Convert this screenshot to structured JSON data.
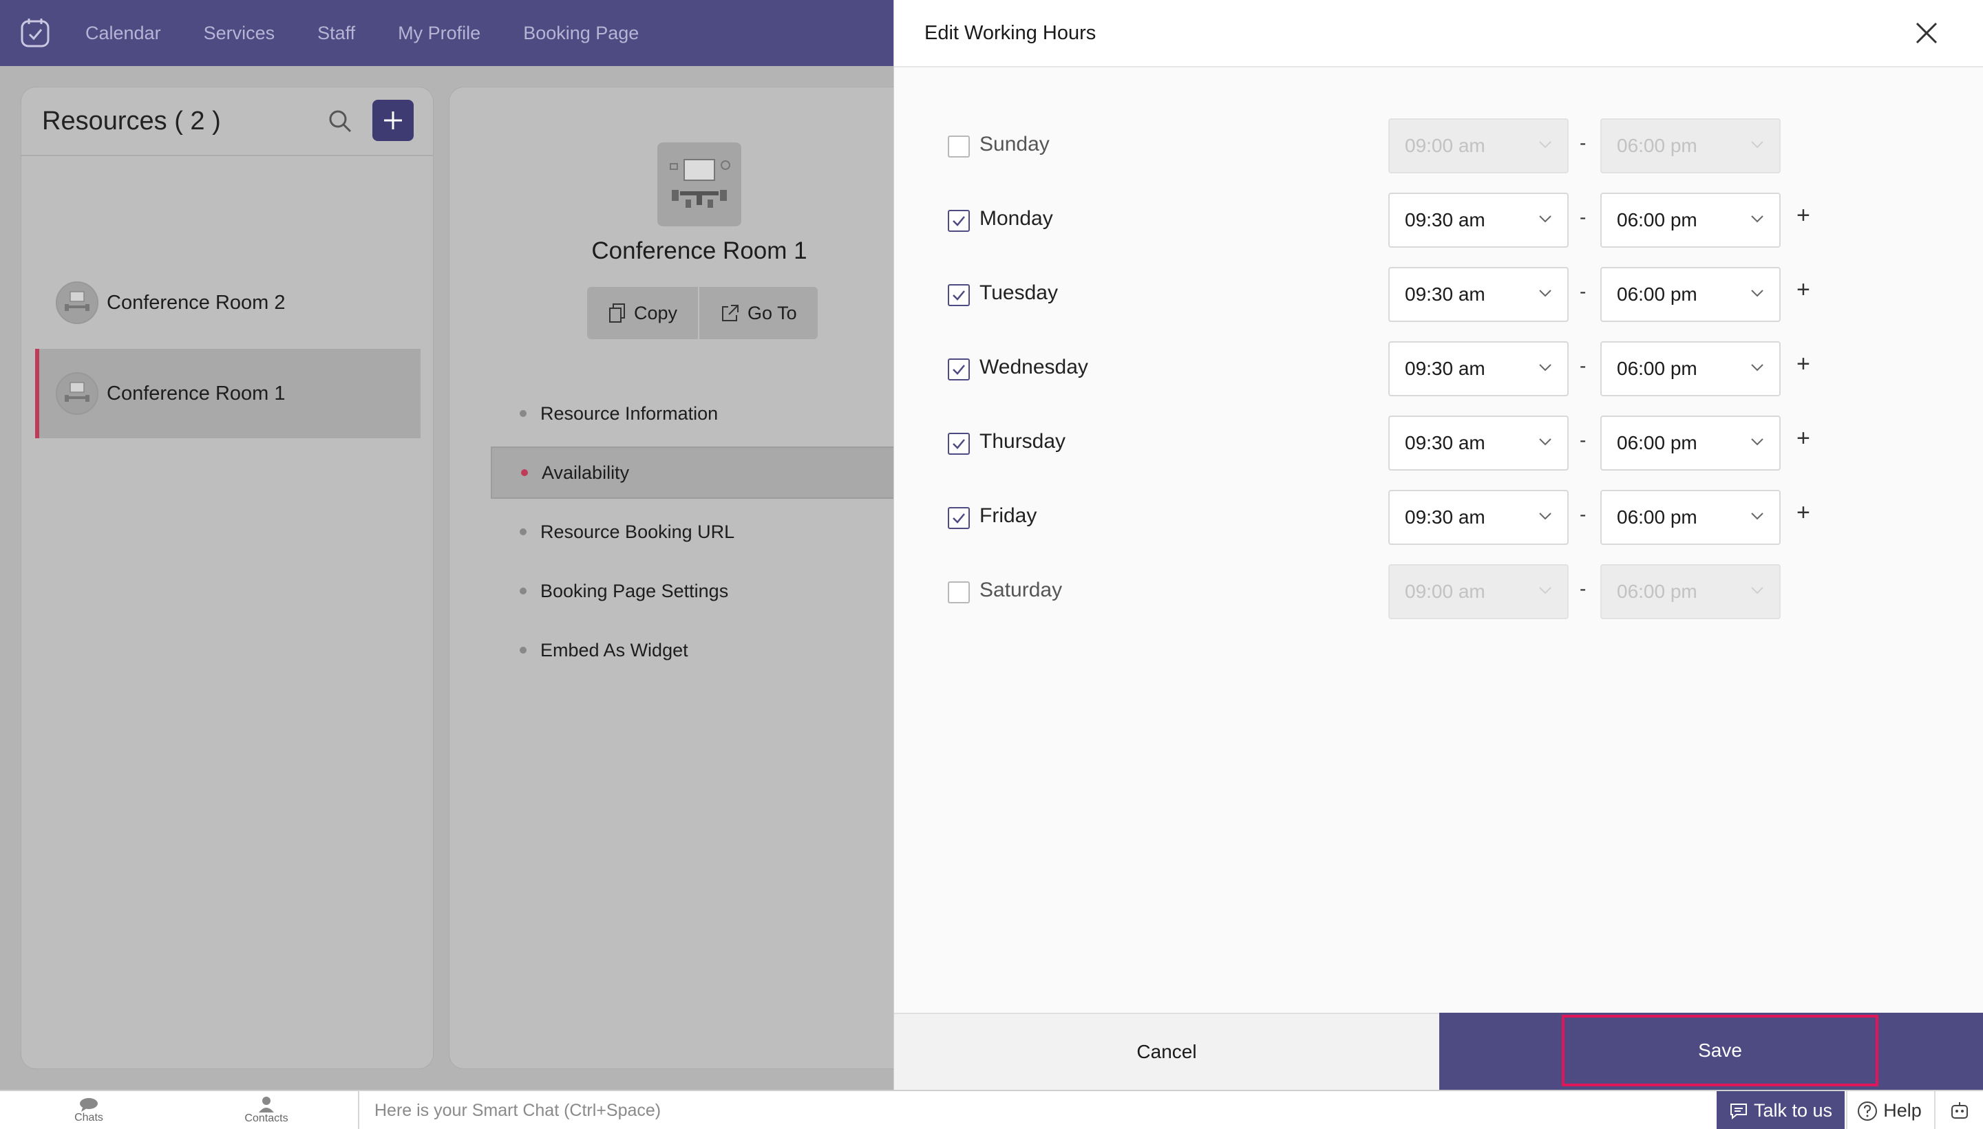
{
  "nav": {
    "logo_icon": "calendar-clock-logo",
    "items": [
      "Calendar",
      "Services",
      "Staff",
      "My Profile",
      "Booking Page"
    ]
  },
  "resources": {
    "title": "Resources ( 2 )",
    "items": [
      {
        "name": "Conference Room 2",
        "active": false
      },
      {
        "name": "Conference Room 1",
        "active": true
      }
    ]
  },
  "detail": {
    "room_name": "Conference Room 1",
    "copy_label": "Copy",
    "goto_label": "Go To",
    "menu": [
      {
        "label": "Resource Information",
        "active": false
      },
      {
        "label": "Availability",
        "active": true
      },
      {
        "label": "Resource Booking URL",
        "active": false
      },
      {
        "label": "Booking Page Settings",
        "active": false
      },
      {
        "label": "Embed As Widget",
        "active": false
      }
    ]
  },
  "drawer": {
    "title": "Edit Working Hours",
    "days": [
      {
        "day": "Sunday",
        "checked": false,
        "start": "09:00 am",
        "end": "06:00 pm"
      },
      {
        "day": "Monday",
        "checked": true,
        "start": "09:30 am",
        "end": "06:00 pm"
      },
      {
        "day": "Tuesday",
        "checked": true,
        "start": "09:30 am",
        "end": "06:00 pm"
      },
      {
        "day": "Wednesday",
        "checked": true,
        "start": "09:30 am",
        "end": "06:00 pm"
      },
      {
        "day": "Thursday",
        "checked": true,
        "start": "09:30 am",
        "end": "06:00 pm"
      },
      {
        "day": "Friday",
        "checked": true,
        "start": "09:30 am",
        "end": "06:00 pm"
      },
      {
        "day": "Saturday",
        "checked": false,
        "start": "09:00 am",
        "end": "06:00 pm"
      }
    ],
    "separator": "-",
    "add_symbol": "+",
    "cancel_label": "Cancel",
    "save_label": "Save"
  },
  "chatbar": {
    "chats_label": "Chats",
    "contacts_label": "Contacts",
    "placeholder": "Here is your Smart Chat (Ctrl+Space)",
    "talk_label": "Talk to us",
    "help_label": "Help"
  },
  "colors": {
    "brand": "#4e4a82",
    "accent": "#c03a5a",
    "highlight": "#e0155a"
  }
}
